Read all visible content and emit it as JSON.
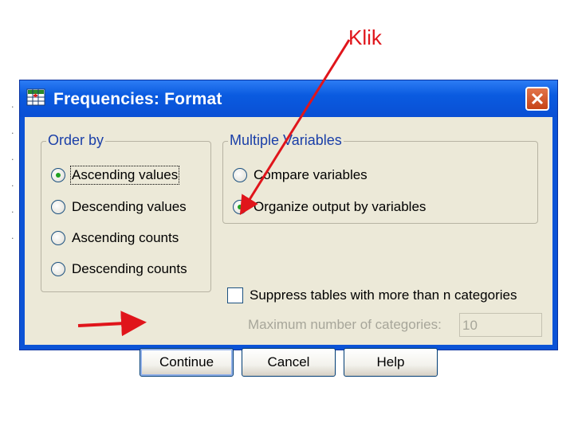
{
  "annotation": {
    "label": "Klik"
  },
  "window": {
    "title": "Frequencies: Format",
    "title_icon": "spss-table-icon",
    "close_icon": "close-icon"
  },
  "order_by": {
    "legend": "Order by",
    "options": [
      {
        "label": "Ascending values",
        "checked": true
      },
      {
        "label": "Descending values",
        "checked": false
      },
      {
        "label": "Ascending counts",
        "checked": false
      },
      {
        "label": "Descending counts",
        "checked": false
      }
    ]
  },
  "multiple_variables": {
    "legend": "Multiple Variables",
    "options": [
      {
        "label": "Compare variables",
        "checked": false
      },
      {
        "label": "Organize output by variables",
        "checked": true
      }
    ]
  },
  "suppress": {
    "label": "Suppress tables with more than n categories",
    "checked": false,
    "max_label": "Maximum number of categories:",
    "max_value": "10"
  },
  "buttons": {
    "continue": "Continue",
    "cancel": "Cancel",
    "help": "Help"
  },
  "colors": {
    "annotation": "#e0151b",
    "titlebar": "#0a5be0",
    "dialog_bg": "#ece9d8",
    "group_legend": "#1a3fa8"
  }
}
